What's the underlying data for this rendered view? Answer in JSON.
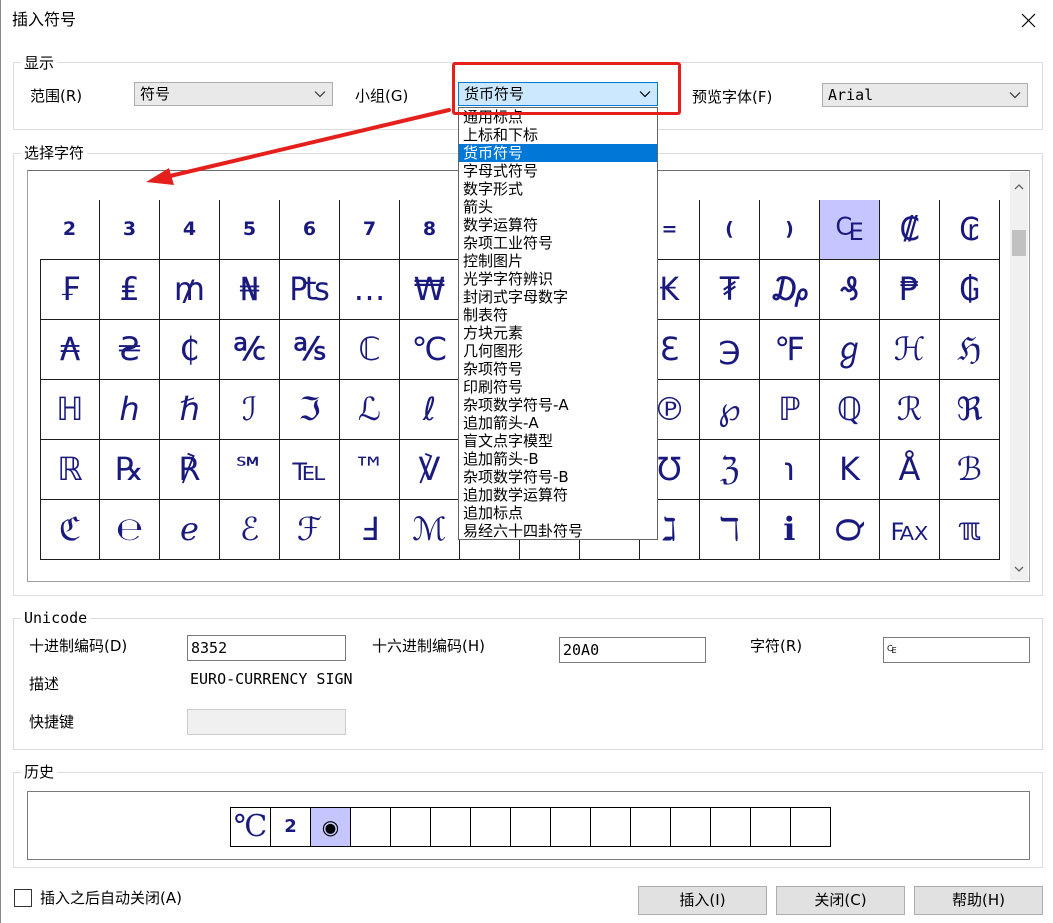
{
  "window": {
    "title": "插入符号",
    "close_icon": "close-icon"
  },
  "display": {
    "group_label": "显示",
    "range_label": "范围(R)",
    "range_value": "符号",
    "subset_label": "小组(G)",
    "subset_value": "货币符号",
    "font_label": "预览字体(F)",
    "font_value": "Arial",
    "dropdown_icon": "chevron-down-icon"
  },
  "subset_list": {
    "items": [
      "通用标点",
      "上标和下标",
      "货币符号",
      "字母式符号",
      "数字形式",
      "箭头",
      "数学运算符",
      "杂项工业符号",
      "控制图片",
      "光学字符辨识",
      "封闭式字母数字",
      "制表符",
      "方块元素",
      "几何图形",
      "杂项符号",
      "印刷符号",
      "杂项数学符号-A",
      "追加箭头-A",
      "盲文点字模型",
      "追加箭头-B",
      "杂项数学符号-B",
      "追加数学运算符",
      "追加标点",
      "易经六十四卦符号"
    ],
    "selected_index": 2
  },
  "select": {
    "group_label": "选择字符",
    "scroll_up_icon": "chevron-up-icon",
    "scroll_down_icon": "chevron-down-icon"
  },
  "grid": {
    "rows": [
      [
        "2",
        "3",
        "4",
        "5",
        "6",
        "7",
        "8",
        "",
        "",
        "",
        "=",
        "(",
        ")",
        "₠",
        "₡",
        "₢"
      ],
      [
        "₣",
        "₤",
        "₥",
        "₦",
        "₧",
        "…",
        "₩",
        "",
        "",
        "",
        "₭",
        "₮",
        "₯",
        "₰",
        "₱",
        "₲"
      ],
      [
        "₳",
        "₴",
        "₵",
        "℀",
        "℁",
        "ℂ",
        "℃",
        "",
        "",
        "",
        "ℇ",
        "℈",
        "℉",
        "ℊ",
        "ℋ",
        "ℌ"
      ],
      [
        "ℍ",
        "ℎ",
        "ℏ",
        "ℐ",
        "ℑ",
        "ℒ",
        "ℓ",
        "",
        "",
        "",
        "℗",
        "℘",
        "ℙ",
        "ℚ",
        "ℛ",
        "ℜ"
      ],
      [
        "ℝ",
        "℞",
        "℟",
        "℠",
        "℡",
        "™",
        "℣",
        "",
        "",
        "",
        "℧",
        "ℨ",
        "℩",
        "K",
        "Å",
        "ℬ"
      ],
      [
        "ℭ",
        "℮",
        "ℯ",
        "ℰ",
        "ℱ",
        "Ⅎ",
        "ℳ",
        "",
        "",
        "",
        "ℷ",
        "ℸ",
        "ℹ",
        "℺",
        "℻",
        "ℼ"
      ]
    ],
    "selected": {
      "row": 0,
      "col": 13
    }
  },
  "unicode": {
    "group_label": "Unicode",
    "decimal_label": "十进制编码(D)",
    "decimal_value": "8352",
    "hex_label": "十六进制编码(H)",
    "hex_value": "20A0",
    "char_label": "字符(R)",
    "char_value": "₠",
    "desc_label": "描述",
    "desc_value": "EURO-CURRENCY SIGN",
    "shortcut_label": "快捷键"
  },
  "history": {
    "group_label": "历史",
    "cells": [
      "℃",
      "2",
      "◉",
      "",
      "",
      "",
      "",
      "",
      "",
      "",
      "",
      "",
      "",
      "",
      ""
    ],
    "selected_index": 2
  },
  "footer": {
    "auto_close_label": "插入之后自动关闭(A)",
    "auto_close_checked": false,
    "insert_label": "插入(I)",
    "close_label": "关闭(C)",
    "help_label": "帮助(H)"
  },
  "colors": {
    "accent": "#0078d7",
    "glyph": "#1a1a7e",
    "selected_cell": "#c5c5ff",
    "annotation_red": "#e5201c"
  }
}
